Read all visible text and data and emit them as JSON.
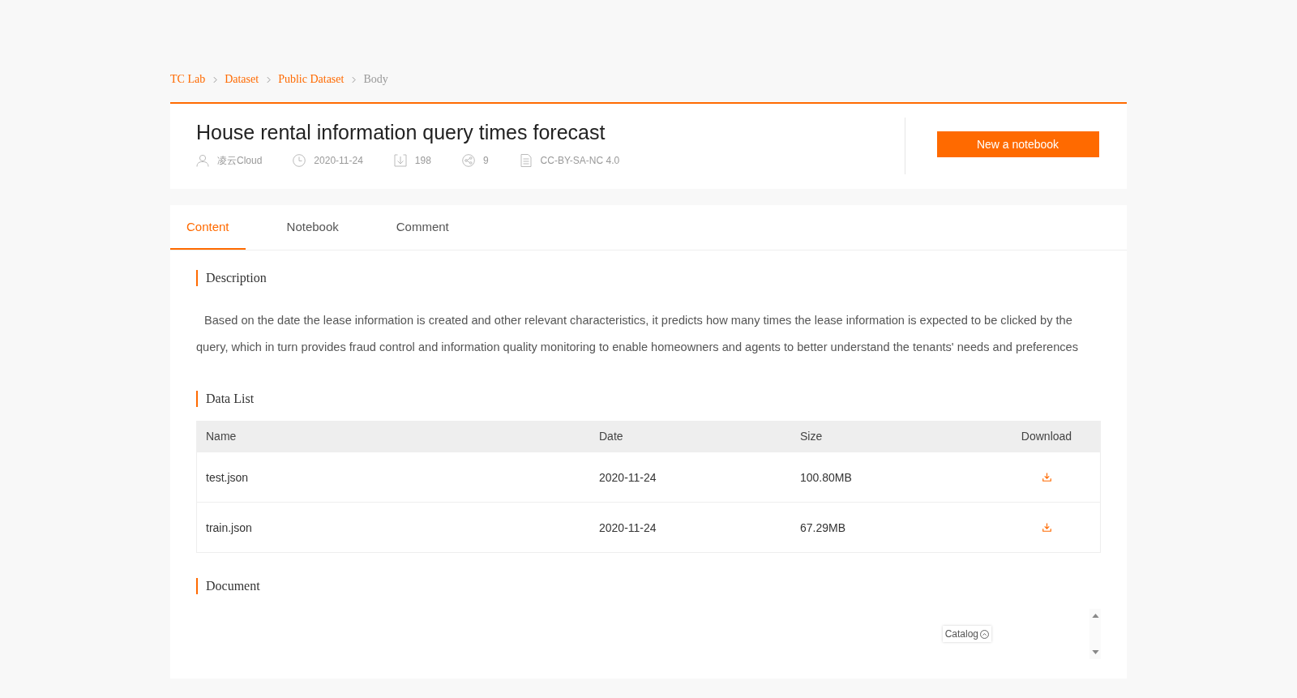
{
  "breadcrumb": [
    {
      "label": "TC Lab",
      "current": false
    },
    {
      "label": "Dataset",
      "current": false
    },
    {
      "label": "Public Dataset",
      "current": false
    },
    {
      "label": "Body",
      "current": true
    }
  ],
  "dataset": {
    "title": "House rental information query times forecast",
    "meta": [
      {
        "kind": "author",
        "text": "凌云Cloud"
      },
      {
        "kind": "date",
        "text": "2020-11-24"
      },
      {
        "kind": "downloads",
        "text": "198"
      },
      {
        "kind": "shares",
        "text": "9"
      },
      {
        "kind": "license",
        "text": "CC-BY-SA-NC 4.0"
      }
    ],
    "action_button": "New a notebook"
  },
  "tabs": [
    {
      "label": "Content",
      "selected": true
    },
    {
      "label": "Notebook",
      "selected": false
    },
    {
      "label": "Comment",
      "selected": false
    }
  ],
  "description": {
    "heading": "Description",
    "text": "Based on the date the lease information is created and other relevant characteristics, it predicts how many times the lease information is expected to be clicked by the query, which in turn provides fraud control and information quality monitoring to enable homeowners and agents to better understand the tenants' needs and preferences"
  },
  "data_list": {
    "heading": "Data List",
    "columns": [
      "Name",
      "Date",
      "Size",
      "Download"
    ],
    "rows": [
      {
        "name": "test.json",
        "date": "2020-11-24",
        "size": "100.80MB"
      },
      {
        "name": "train.json",
        "date": "2020-11-24",
        "size": "67.29MB"
      }
    ]
  },
  "document": {
    "heading": "Document",
    "catalog_button": "Catalog"
  }
}
